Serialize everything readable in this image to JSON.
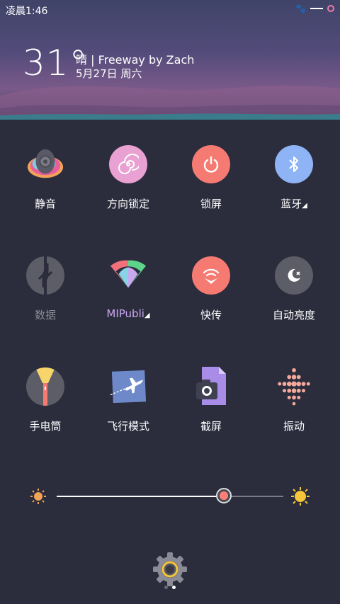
{
  "status": {
    "time": "凌晨1:46"
  },
  "weather": {
    "temp": "31°",
    "line1": "晴 | Freeway by Zach",
    "line2": "5月27日 周六"
  },
  "tiles": [
    {
      "label": "静音"
    },
    {
      "label": "方向锁定"
    },
    {
      "label": "锁屏"
    },
    {
      "label": "蓝牙",
      "suffix": "◢"
    },
    {
      "label": "数据"
    },
    {
      "label": "MIPubli",
      "suffix": "◢"
    },
    {
      "label": "快传"
    },
    {
      "label": "自动亮度"
    },
    {
      "label": "手电筒"
    },
    {
      "label": "飞行模式"
    },
    {
      "label": "截屏"
    },
    {
      "label": "振动"
    }
  ],
  "colors": {
    "background": "#2b2c3c",
    "accent_red": "#f57b72",
    "accent_blue": "#8fb4f5",
    "lock_pink": "#e8a1d2",
    "label_dim": "#8b8b95",
    "wifi_label": "#c9a8f0"
  },
  "brightness": {
    "level": 0.72
  },
  "pager": {
    "pages": 2,
    "current": 2
  }
}
